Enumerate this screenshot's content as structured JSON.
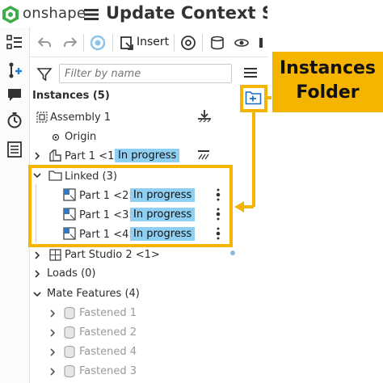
{
  "header": {
    "brand": "onshape",
    "document_title": "Update Context Sample"
  },
  "toolbar": {
    "insert_label": "Insert"
  },
  "filter": {
    "placeholder": "Filter by name"
  },
  "instances": {
    "header": "Instances (5)",
    "assembly_label": "Assembly 1",
    "origin_label": "Origin",
    "part1_label": "Part 1 <1>",
    "part1_status": "In progress",
    "folder_label": "Linked (3)",
    "linked_items": [
      {
        "label": "Part 1 <2>",
        "status": "In progress"
      },
      {
        "label": "Part 1 <3>",
        "status": "In progress"
      },
      {
        "label": "Part 1 <4>",
        "status": "In progress"
      }
    ],
    "part_studio_label": "Part Studio 2 <1>"
  },
  "loads": {
    "label": "Loads (0)"
  },
  "mate_features": {
    "label": "Mate Features (4)",
    "items": [
      "Fastened 1",
      "Fastened 2",
      "Fastened 4",
      "Fastened 3"
    ]
  },
  "annotation": {
    "line1": "Instances",
    "line2": "Folder",
    "color": "#f5b400"
  },
  "colors": {
    "status_badge": "#8fd0f2",
    "onshape_green": "#3fae49"
  }
}
